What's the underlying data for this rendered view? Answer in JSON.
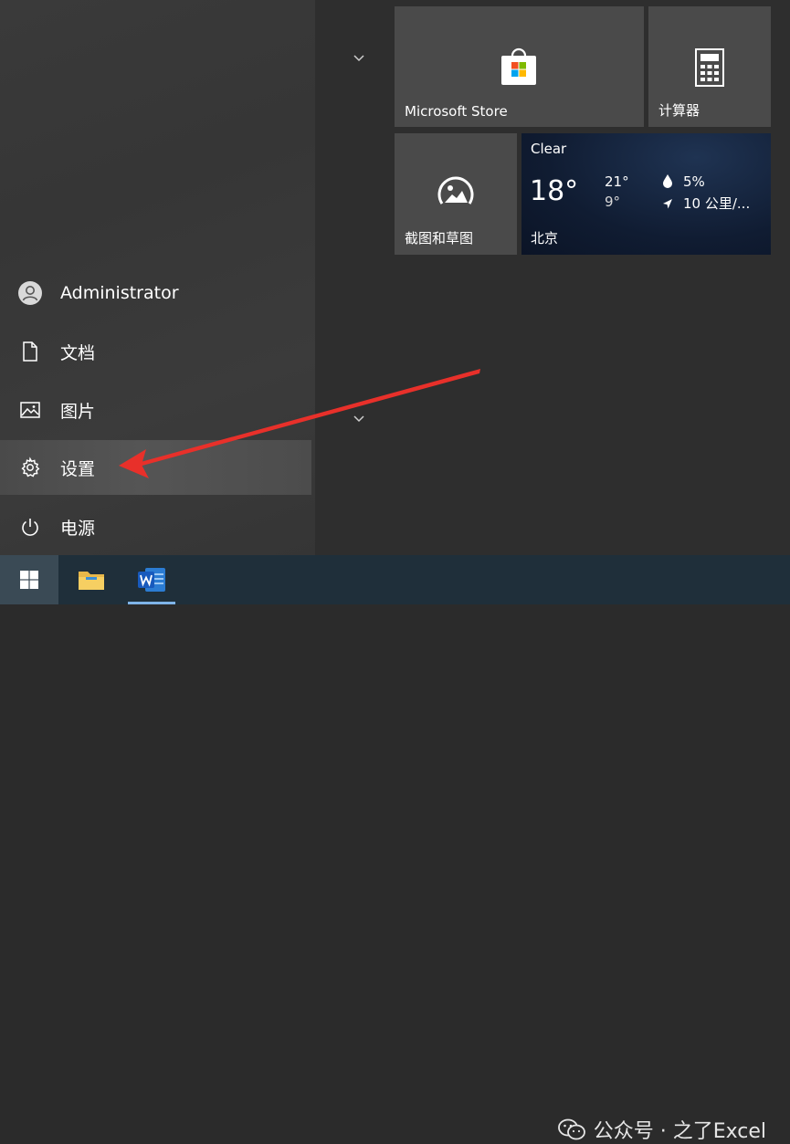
{
  "user": {
    "name": "Administrator"
  },
  "rail": {
    "documents": "文档",
    "pictures": "图片",
    "settings": "设置",
    "power": "电源"
  },
  "tiles": {
    "store": {
      "label": "Microsoft Store"
    },
    "calculator": {
      "label": "计算器"
    },
    "snip": {
      "label": "截图和草图"
    },
    "weather": {
      "condition": "Clear",
      "temp": "18°",
      "high": "21°",
      "low": "9°",
      "precip": "5%",
      "wind": "10 公里/...",
      "city": "北京"
    }
  },
  "watermark": {
    "text": "公众号 · 之了Excel"
  },
  "colors": {
    "arrow": "#e8302a",
    "store_red": "#f25022",
    "store_green": "#7fba00",
    "store_blue": "#00a4ef",
    "store_yellow": "#ffb900"
  }
}
